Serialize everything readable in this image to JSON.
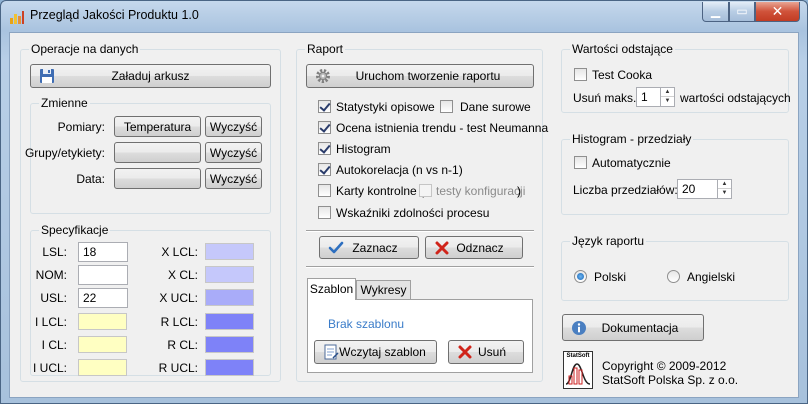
{
  "window": {
    "title": "Przegląd Jakości Produktu 1.0",
    "minimize": "▁",
    "maximize": "▭",
    "close": "✕"
  },
  "ops": {
    "title": "Operacje na danych",
    "load_button": "Załaduj arkusz",
    "variables": {
      "title": "Zmienne",
      "rows": [
        {
          "label": "Pomiary:",
          "value": "Temperatura",
          "clear": "Wyczyść"
        },
        {
          "label": "Grupy/etykiety:",
          "value": "",
          "clear": "Wyczyść"
        },
        {
          "label": "Data:",
          "value": "",
          "clear": "Wyczyść"
        }
      ]
    }
  },
  "spec": {
    "title": "Specyfikacje",
    "lsl": {
      "label": "LSL:",
      "value": "18"
    },
    "nom": {
      "label": "NOM:",
      "value": ""
    },
    "usl": {
      "label": "USL:",
      "value": "22"
    },
    "xlcl": {
      "label": "X LCL:",
      "color": "#c5c8fb"
    },
    "xcl": {
      "label": "X CL:",
      "color": "#c5c8fb"
    },
    "xucl": {
      "label": "X UCL:",
      "color": "#a9acf9"
    },
    "ilcl": {
      "label": "I LCL:",
      "color": "#ffffc2"
    },
    "icl": {
      "label": "I CL:",
      "color": "#ffffc2"
    },
    "iucl": {
      "label": "I UCL:",
      "color": "#ffffc2"
    },
    "rlcl": {
      "label": "R LCL:",
      "color": "#7e82f8"
    },
    "rcl": {
      "label": "R CL:",
      "color": "#7e82f8"
    },
    "rucl": {
      "label": "R UCL:",
      "color": "#7e82f8"
    }
  },
  "report": {
    "title": "Raport",
    "run_button": "Uruchom tworzenie raportu",
    "options": {
      "desc_stats": {
        "label": "Statystyki opisowe",
        "checked": true
      },
      "raw_data": {
        "label": "Dane surowe",
        "checked": false
      },
      "trend_test": {
        "label": "Ocena istnienia trendu - test Neumanna",
        "checked": true
      },
      "histogram": {
        "label": "Histogram",
        "checked": true
      },
      "autocorr": {
        "label": "Autokorelacja (n vs n-1)",
        "checked": true
      },
      "control_charts": {
        "label": "Karty kontrolne (",
        "checked": false
      },
      "test_config": {
        "label": "testy konfiguracji",
        "checked": false
      },
      "paren_close": ")",
      "capability": {
        "label": "Wskaźniki zdolności procesu",
        "checked": false
      }
    },
    "select_all": "Zaznacz",
    "deselect_all": "Odznacz",
    "tabs": [
      "Szablon",
      "Wykresy"
    ],
    "no_template": "Brak szablonu",
    "load_template": "Wczytaj szablon",
    "remove": "Usuń"
  },
  "outliers": {
    "title": "Wartości odstające",
    "cook_test": {
      "label": "Test Cooka",
      "checked": false
    },
    "remove_max_label": "Usuń maks.",
    "remove_max_value": "1",
    "suffix": "wartości odstających"
  },
  "histogram": {
    "title": "Histogram - przedziały",
    "auto": {
      "label": "Automatycznie",
      "checked": false
    },
    "bins_label": "Liczba przedziałów:",
    "bins_value": "20"
  },
  "language": {
    "title": "Język raportu",
    "polish": {
      "label": "Polski",
      "selected": true
    },
    "english": {
      "label": "Angielski",
      "selected": false
    }
  },
  "docs_button": "Dokumentacja",
  "copyright": {
    "line1": "Copyright © 2009-2012",
    "line2": "StatSoft Polska Sp. z o.o.",
    "logo_text": "StatSoft"
  }
}
